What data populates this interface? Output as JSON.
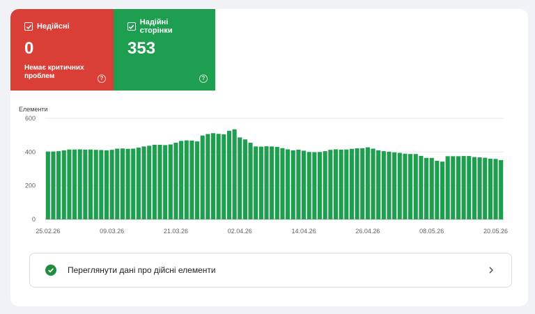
{
  "tiles": {
    "invalid": {
      "label": "Недійсні",
      "value": "0",
      "sub": "Немає критичних проблем",
      "color": "#d93f36"
    },
    "valid": {
      "label": "Надійні сторінки",
      "value": "353",
      "color": "#1e9e4f"
    }
  },
  "chart_data": {
    "type": "bar",
    "ylabel": "Елементи",
    "ylim": [
      0,
      600
    ],
    "yticks": [
      "0",
      "200",
      "400",
      "600"
    ],
    "xticks": [
      "25.02.26",
      "09.03.26",
      "21.03.26",
      "02.04.26",
      "14.04.26",
      "26.04.26",
      "08.05.26",
      "20.05.26"
    ],
    "bar_color": "#1e9e4f",
    "values": [
      403,
      403,
      405,
      410,
      415,
      415,
      416,
      414,
      415,
      413,
      412,
      410,
      413,
      420,
      421,
      419,
      420,
      426,
      433,
      437,
      443,
      443,
      441,
      445,
      455,
      466,
      469,
      468,
      463,
      498,
      507,
      512,
      508,
      505,
      526,
      535,
      487,
      475,
      455,
      433,
      432,
      434,
      433,
      430,
      423,
      416,
      410,
      414,
      408,
      400,
      399,
      400,
      405,
      413,
      416,
      414,
      415,
      419,
      422,
      422,
      428,
      420,
      410,
      405,
      402,
      398,
      395,
      390,
      388,
      388,
      377,
      365,
      365,
      348,
      343,
      375,
      375,
      375,
      376,
      376,
      370,
      368,
      366,
      360,
      359,
      352
    ]
  },
  "action": {
    "label": "Переглянути дані про дійсні елементи"
  }
}
